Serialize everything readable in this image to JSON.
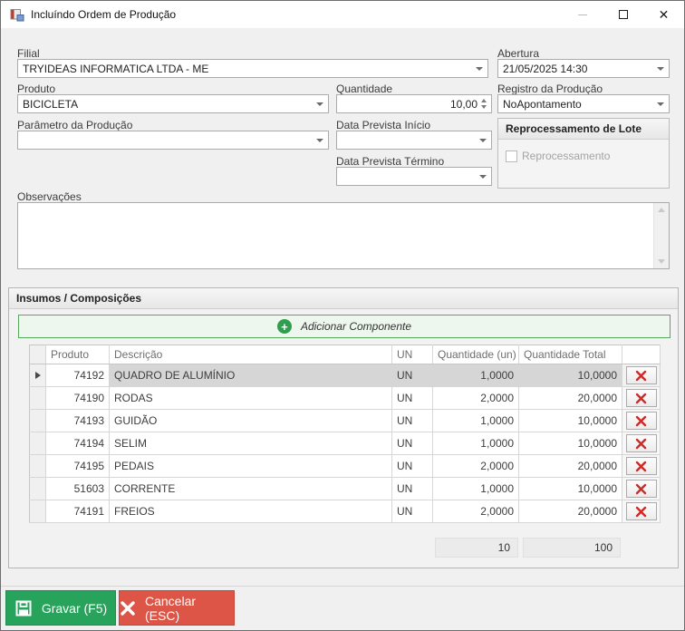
{
  "window": {
    "title": "Incluíndo Ordem de Produção"
  },
  "form": {
    "filial": {
      "label": "Filial",
      "value": "TRYIDEAS INFORMATICA LTDA - ME"
    },
    "abertura": {
      "label": "Abertura",
      "value": "21/05/2025 14:30"
    },
    "produto": {
      "label": "Produto",
      "value": "BICICLETA"
    },
    "quantidade": {
      "label": "Quantidade",
      "value": "10,00"
    },
    "registro": {
      "label": "Registro da Produção",
      "value": "NoApontamento"
    },
    "parametro": {
      "label": "Parâmetro da Produção",
      "value": ""
    },
    "data_inicio": {
      "label": "Data Prevista Início",
      "value": ""
    },
    "data_termino": {
      "label": "Data Prevista Término",
      "value": ""
    },
    "reprocessamento": {
      "title": "Reprocessamento de Lote",
      "checkbox_label": "Reprocessamento",
      "checked": false
    },
    "observacoes": {
      "label": "Observações",
      "value": ""
    }
  },
  "insumos": {
    "title": "Insumos / Composições",
    "add_button_label": "Adicionar Componente",
    "grid": {
      "columns": [
        "Produto",
        "Descrição",
        "UN",
        "Quantidade (un)",
        "Quantidade Total"
      ],
      "rows": [
        {
          "produto": "74192",
          "descricao": "QUADRO DE ALUMÍNIO",
          "un": "UN",
          "quantidade": "1,0000",
          "quantidade_total": "10,0000"
        },
        {
          "produto": "74190",
          "descricao": "RODAS",
          "un": "UN",
          "quantidade": "2,0000",
          "quantidade_total": "20,0000"
        },
        {
          "produto": "74193",
          "descricao": "GUIDÃO",
          "un": "UN",
          "quantidade": "1,0000",
          "quantidade_total": "10,0000"
        },
        {
          "produto": "74194",
          "descricao": "SELIM",
          "un": "UN",
          "quantidade": "1,0000",
          "quantidade_total": "10,0000"
        },
        {
          "produto": "74195",
          "descricao": "PEDAIS",
          "un": "UN",
          "quantidade": "2,0000",
          "quantidade_total": "20,0000"
        },
        {
          "produto": "51603",
          "descricao": "CORRENTE",
          "un": "UN",
          "quantidade": "1,0000",
          "quantidade_total": "10,0000"
        },
        {
          "produto": "74191",
          "descricao": "FREIOS",
          "un": "UN",
          "quantidade": "2,0000",
          "quantidade_total": "20,0000"
        }
      ],
      "totals": {
        "quantidade": "10",
        "quantidade_total": "100"
      }
    }
  },
  "footer": {
    "save_label": "Gravar (F5)",
    "cancel_label": "Cancelar (ESC)"
  },
  "colors": {
    "save_green": "#28a35b",
    "cancel_red": "#dd5546",
    "add_button_bg": "#edf7ed",
    "add_button_border": "#57a85c",
    "delete_x_red": "#cc2b28",
    "selected_row_bg": "#d6d6d6"
  }
}
